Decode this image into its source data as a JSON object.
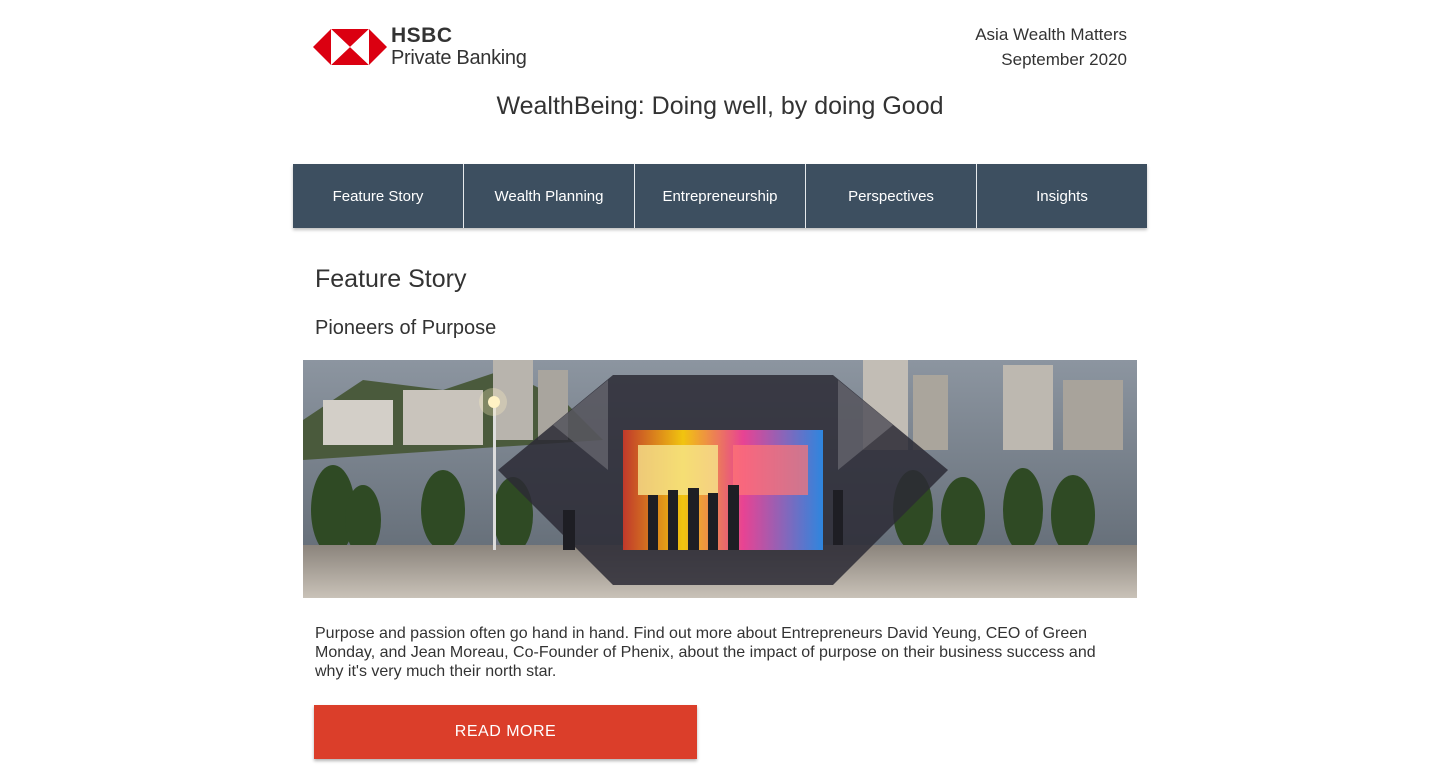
{
  "header": {
    "brand": "HSBC",
    "sub_brand": "Private Banking",
    "publication": "Asia Wealth Matters",
    "issue_date": "September 2020",
    "headline": "WealthBeing: Doing well, by doing Good",
    "brand_red": "#db0011"
  },
  "nav": {
    "items": [
      {
        "label": "Feature Story"
      },
      {
        "label": "Wealth Planning"
      },
      {
        "label": "Entrepreneurship"
      },
      {
        "label": "Perspectives"
      },
      {
        "label": "Insights"
      }
    ],
    "background": "#3d4f60"
  },
  "feature": {
    "section_title": "Feature Story",
    "story_title": "Pioneers of Purpose",
    "image_icon": "hsbc-hexagon-photo",
    "body": "Purpose and passion often go hand in hand. Find out more about Entrepreneurs David Yeung, CEO of Green Monday, and Jean Moreau, Co-Founder of Phenix, about the impact of purpose on their business success and why it's very much their north star.",
    "cta_label": "READ MORE",
    "cta_color": "#db3e2a"
  }
}
